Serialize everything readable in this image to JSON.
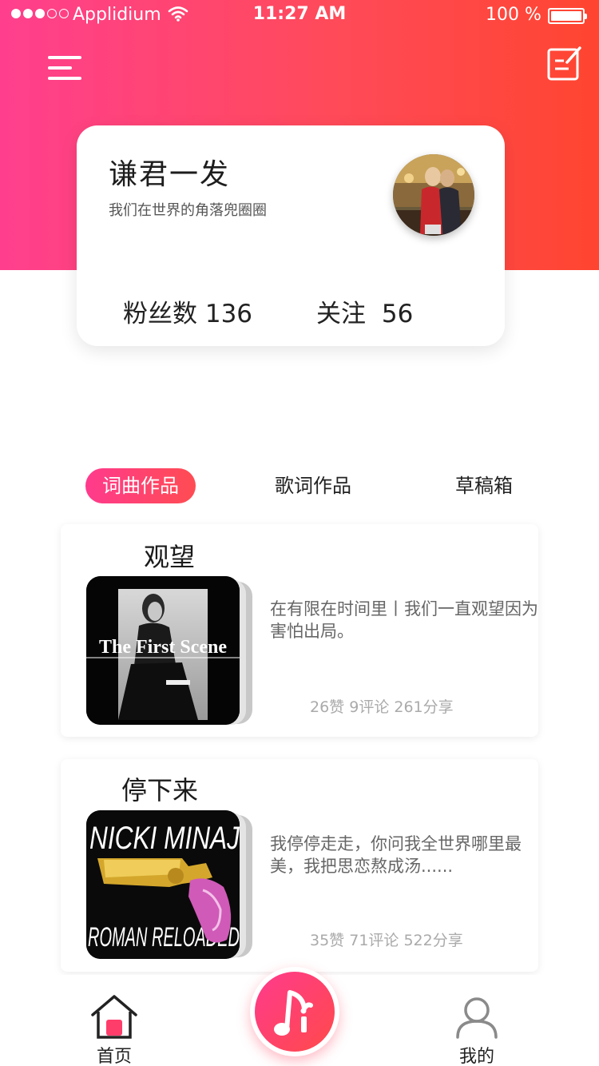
{
  "status_bar": {
    "carrier": "Applidium",
    "time": "11:27 AM",
    "battery": "100 %"
  },
  "header": {
    "menu_icon": "menu-icon",
    "edit_icon": "edit-icon"
  },
  "profile": {
    "name": "谦君一发",
    "bio": "我们在世界的角落兜圈圈",
    "fans_label": "粉丝数",
    "fans_count": "136",
    "follow_label": "关注",
    "follow_count": "56"
  },
  "tabs": [
    {
      "label": "词曲作品",
      "active": true
    },
    {
      "label": "歌词作品",
      "active": false
    },
    {
      "label": "草稿箱",
      "active": false
    }
  ],
  "works": [
    {
      "title": "观望",
      "cover_text": "The First Scene",
      "lyric": "在有限在时间里丨我们一直观望因为害怕出局。",
      "likes": "26赞",
      "comments": "9评论",
      "shares": "261分享"
    },
    {
      "title": "停下来",
      "cover_text_top": "NICKI MINAJ",
      "cover_text_bottom": "ROMAN RELOADED",
      "lyric": "我停停走走，你问我全世界哪里最美，我把思恋熬成汤......",
      "likes": "35赞",
      "comments": "71评论",
      "shares": "522分享"
    }
  ],
  "bottom_nav": {
    "home_label": "首页",
    "mine_label": "我的",
    "compose_icon": "music-note-icon"
  },
  "colors": {
    "accent_start": "#ff3f8e",
    "accent_end": "#ff4530"
  }
}
